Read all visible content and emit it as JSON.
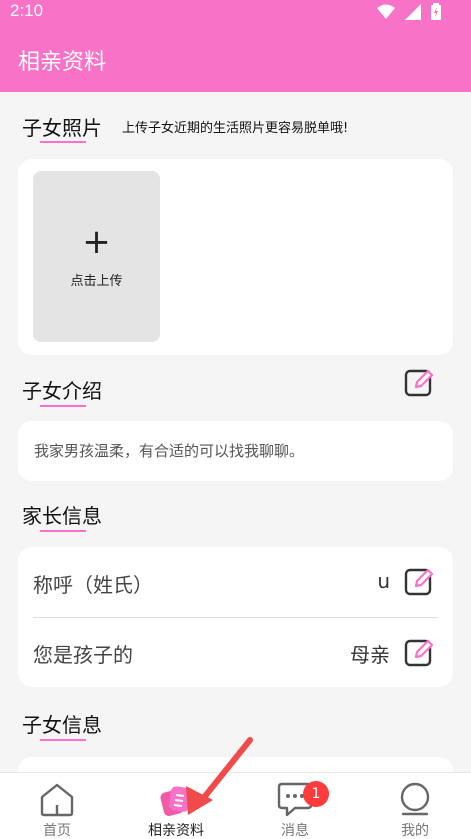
{
  "status": {
    "time": "2:10"
  },
  "appbar": {
    "title": "相亲资料"
  },
  "photos": {
    "title": "子女照片",
    "hint": "上传子女近期的生活照片更容易脱单哦!",
    "upload_plus": "+",
    "upload_label": "点击上传"
  },
  "intro": {
    "title": "子女介绍",
    "text": "我家男孩温柔，有合适的可以找我聊聊。"
  },
  "parent": {
    "title": "家长信息",
    "rows": [
      {
        "label": "称呼（姓氏）",
        "value": "u"
      },
      {
        "label": "您是孩子的",
        "value": "母亲"
      }
    ]
  },
  "child": {
    "title": "子女信息"
  },
  "tabs": [
    {
      "label": "首页"
    },
    {
      "label": "相亲资料"
    },
    {
      "label": "消息",
      "badge": "1"
    },
    {
      "label": "我的"
    }
  ],
  "colors": {
    "accent": "#f872c7",
    "badge": "#ff3b3b"
  },
  "icons": [
    "wifi-icon",
    "signal-icon",
    "battery-icon",
    "edit-icon",
    "home-icon",
    "profile-cards-icon",
    "chat-icon",
    "person-icon"
  ]
}
